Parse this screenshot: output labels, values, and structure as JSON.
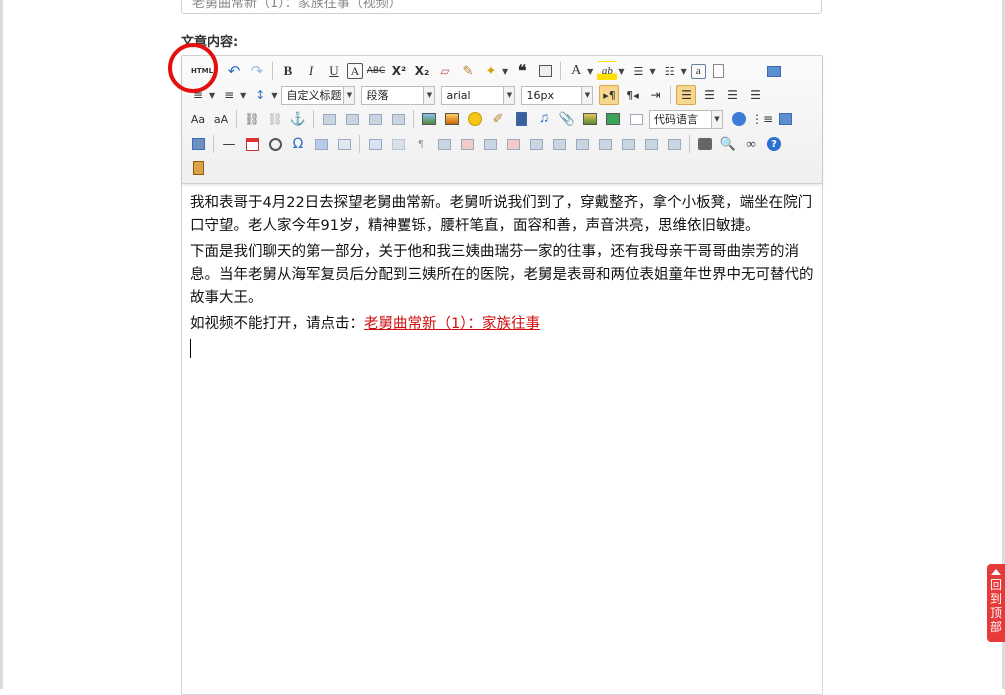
{
  "title_field": {
    "value": "老舅曲常新（1）：家族往事（视频）"
  },
  "label": {
    "content": "文章内容:"
  },
  "toolbar": {
    "html_btn": "HTML",
    "bold": "B",
    "italic": "I",
    "underline": "U",
    "font_border": "A",
    "strike": "ABC",
    "superscript": "X²",
    "subscript": "X₂",
    "blockquote": "❝",
    "forecolor": "A",
    "highlight": "ab",
    "custom_style": "自定义标题",
    "paragraph": "段落",
    "font_family": "arial",
    "font_size": "16px",
    "code_language": "代码语言",
    "omega": "Ω",
    "line": "—"
  },
  "content": {
    "p1": "我和表哥于4月22日去探望老舅曲常新。老舅听说我们到了，穿戴整齐，拿个小板凳，端坐在院门口守望。老人家今年91岁，精神矍铄，腰杆笔直，面容和善，声音洪亮，思维依旧敏捷。",
    "p2": "下面是我们聊天的第一部分，关于他和我三姨曲瑞芬一家的往事，还有我母亲干哥哥曲崇芳的消息。当年老舅从海军复员后分配到三姨所在的医院，老舅是表哥和两位表姐童年世界中无可替代的故事大王。",
    "p3_prefix": "如视频不能打开，请点击：",
    "p3_link": "老舅曲常新（1）：家族往事"
  },
  "back_to_top": {
    "label": "回到顶部"
  }
}
